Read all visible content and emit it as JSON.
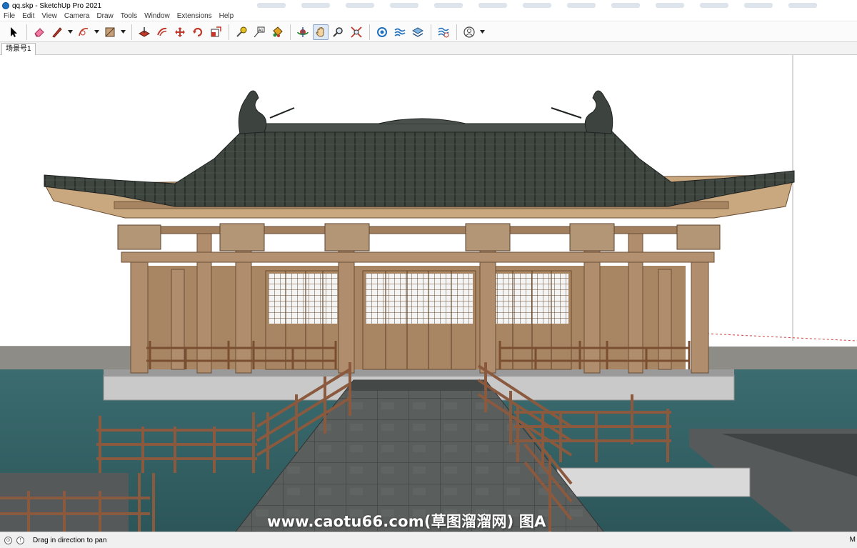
{
  "window": {
    "title": "qq.skp - SketchUp Pro 2021"
  },
  "menu": {
    "items": [
      "File",
      "Edit",
      "View",
      "Camera",
      "Draw",
      "Tools",
      "Window",
      "Extensions",
      "Help"
    ]
  },
  "toolbar": {
    "tools": [
      {
        "name": "select-tool-icon"
      },
      {
        "name": "eraser-tool-icon"
      },
      {
        "name": "line-tool-icon"
      },
      {
        "name": "arc-tool-icon"
      },
      {
        "name": "rectangle-tool-icon"
      },
      {
        "name": "push-pull-tool-icon"
      },
      {
        "name": "offset-tool-icon"
      },
      {
        "name": "move-tool-icon"
      },
      {
        "name": "rotate-tool-icon"
      },
      {
        "name": "scale-tool-icon"
      },
      {
        "name": "tape-measure-tool-icon"
      },
      {
        "name": "text-tool-icon"
      },
      {
        "name": "paint-bucket-tool-icon"
      },
      {
        "name": "orbit-tool-icon"
      },
      {
        "name": "pan-tool-icon"
      },
      {
        "name": "zoom-tool-icon"
      },
      {
        "name": "zoom-extents-tool-icon"
      },
      {
        "name": "3d-warehouse-icon"
      },
      {
        "name": "extension-warehouse-icon"
      },
      {
        "name": "layout-icon"
      },
      {
        "name": "extension-manager-icon"
      },
      {
        "name": "account-icon"
      }
    ],
    "active_tool": "pan-tool-icon"
  },
  "scenes": {
    "tabs": [
      "场景号1"
    ]
  },
  "viewport": {
    "watermark": "www.caotu66.com(草图溜溜网) 图A"
  },
  "status": {
    "message": "Drag in direction to pan",
    "measurements_label": "M"
  },
  "colors": {
    "roof": "#3f4640",
    "timber": "#b08d6c",
    "water": "#3e6e72",
    "stone": "#585b5b",
    "railing": "#8b5a3e"
  }
}
